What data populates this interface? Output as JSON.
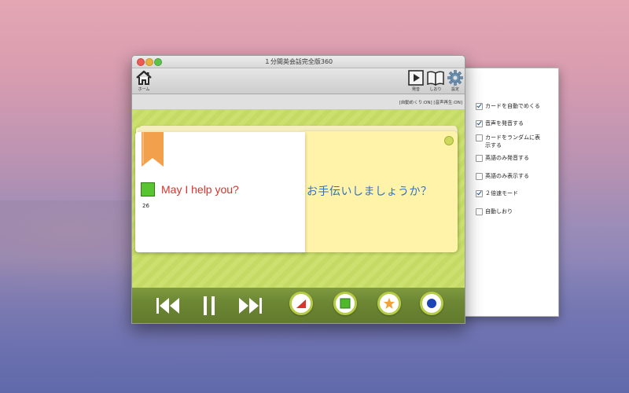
{
  "window": {
    "title": "１分間英会話完全版360"
  },
  "toolbar": {
    "home_label": "ホーム",
    "play_label": "発音",
    "bookmark_label": "しおり",
    "settings_label": "設定"
  },
  "status": {
    "text": "[自動めくり:ON] [音声再生:ON]"
  },
  "card": {
    "number": "26",
    "english": "May I help you?",
    "japanese": "お手伝いしましょうか？",
    "marker_color": "#58c431"
  },
  "options": [
    {
      "label": "カードを自動でめくる",
      "checked": true
    },
    {
      "label": "音声を発音する",
      "checked": true
    },
    {
      "label": "カードをランダムに表示する",
      "checked": false
    },
    {
      "label": "英語のみ発音する",
      "checked": false
    },
    {
      "label": "英語のみ表示する",
      "checked": false
    },
    {
      "label": "２倍速モード",
      "checked": true
    },
    {
      "label": "自動しおり",
      "checked": false
    }
  ],
  "colors": {
    "english_text": "#d8332b",
    "japanese_text": "#2f71c7",
    "content_bg": "#cbe06f",
    "controls_bg": "#6d8734"
  },
  "icons": {
    "home": "home-icon",
    "play": "play-square-icon",
    "bookmark": "open-book-icon",
    "settings": "gear-icon",
    "previous": "skip-previous-icon",
    "pause": "pause-icon",
    "next": "skip-next-icon",
    "triangle": "red-triangle-icon",
    "square": "green-square-icon",
    "star": "orange-star-icon",
    "circle": "blue-circle-icon"
  }
}
